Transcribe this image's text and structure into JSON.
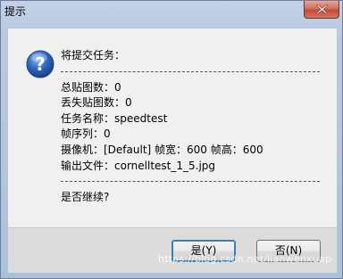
{
  "window": {
    "title": "提示",
    "close_icon": "close-icon"
  },
  "message": {
    "icon": "question-icon",
    "header": "将提交任务：",
    "lines": [
      "总贴图数：0",
      "丢失贴图数：0",
      "任务名称：speedtest",
      "帧序列：0",
      "摄像机：[Default] 帧宽：600 帧高：600",
      "输出文件：cornelltest_1_5.jpg"
    ],
    "question": "是否继续?"
  },
  "buttons": {
    "yes_label": "是(Y)",
    "no_label": "否(N)"
  },
  "watermark": "https://blog.csdn.net/lianwenxuap",
  "colors": {
    "icon_blue": "#2b5fb4",
    "close_red": "#c24a33"
  }
}
